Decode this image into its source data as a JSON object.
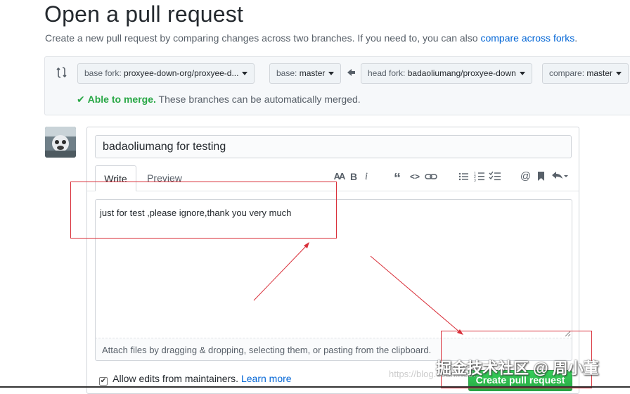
{
  "header": {
    "title": "Open a pull request",
    "subtitle": "Create a new pull request by comparing changes across two branches. If you need to, you can also",
    "subtitle_link": "compare across forks",
    "subtitle_end": "."
  },
  "range": {
    "base_fork_label": "base fork:",
    "base_fork_value": "proxyee-down-org/proxyee-d...",
    "base_label": "base:",
    "base_value": "master",
    "head_fork_label": "head fork:",
    "head_fork_value": "badaoliumang/proxyee-down",
    "compare_label": "compare:",
    "compare_value": "master",
    "merge_ok": "Able to merge.",
    "merge_text": "These branches can be automatically merged."
  },
  "form": {
    "title_value": "badaoliumang for testing",
    "tab_write": "Write",
    "tab_preview": "Preview",
    "body_text": "just for test ,please ignore,thank you very much",
    "attach_text": "Attach files by dragging & dropping, selecting them, or pasting from the clipboard.",
    "allow_edits": "Allow edits from maintainers.",
    "learn_more": "Learn more",
    "submit": "Create pull request",
    "allow_edits_checked": true
  },
  "toolbar": {
    "heading_icon": "AA",
    "bold_icon": "B",
    "italic_icon": "i",
    "quote_icon": "“",
    "code_icon": "<>",
    "link_icon": "link",
    "ul_icon": "☰",
    "ol_icon": "1≡",
    "task_icon": "✓≡",
    "mention_icon": "@",
    "bookmark_icon": "bookmark",
    "reply_icon": "↶"
  },
  "watermark": {
    "text": "掘金技术社区 @ 周小董",
    "url": "https://blog.csdn.net/..."
  },
  "colors": {
    "accent": "#0366d6",
    "success": "#28a745",
    "annotation": "#d9303a"
  }
}
